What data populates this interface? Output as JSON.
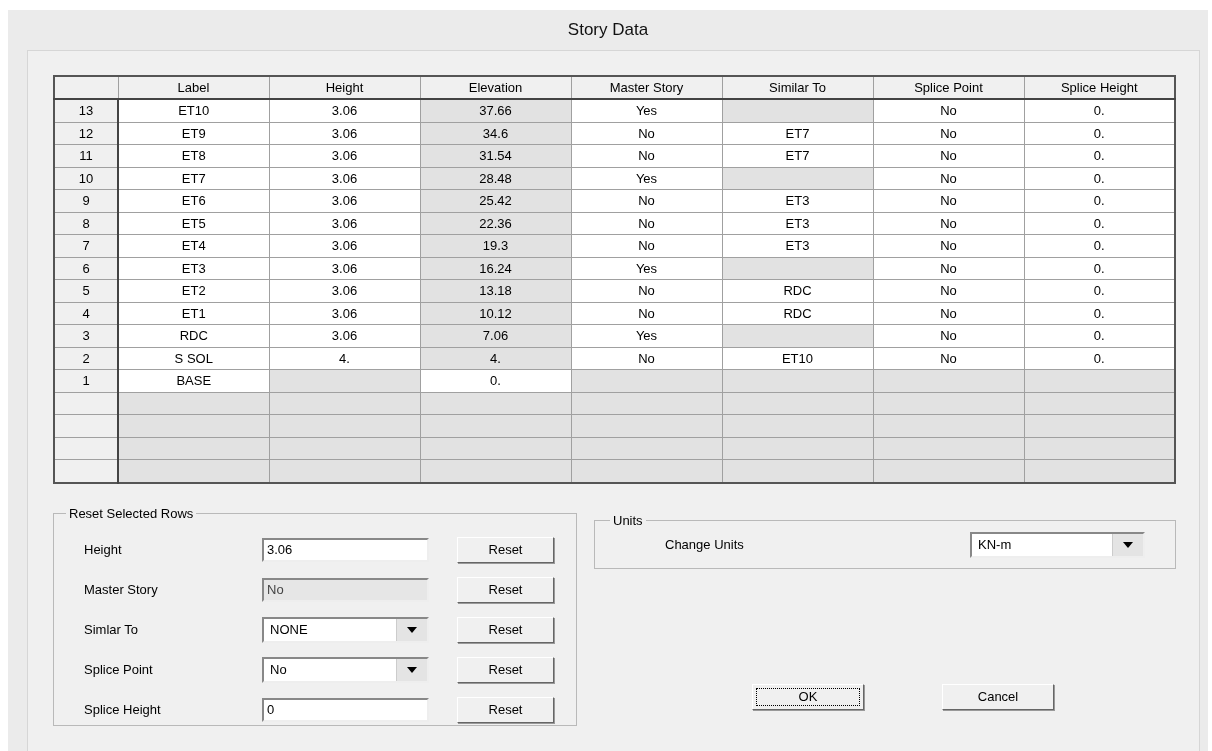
{
  "window": {
    "title": "Story Data"
  },
  "table": {
    "columns": [
      "",
      "Label",
      "Height",
      "Elevation",
      "Master Story",
      "Similar To",
      "Splice Point",
      "Splice Height"
    ],
    "rows": [
      {
        "cells": [
          {
            "kind": "header",
            "text": "13"
          },
          {
            "text": "ET10",
            "shaded": false
          },
          {
            "text": "3.06",
            "shaded": false
          },
          {
            "text": "37.66",
            "shaded": true
          },
          {
            "text": "Yes",
            "shaded": false
          },
          {
            "shaded": true
          },
          {
            "text": "No",
            "shaded": false
          },
          {
            "text": "0.",
            "shaded": false
          }
        ]
      },
      {
        "cells": [
          {
            "kind": "header",
            "text": "12"
          },
          {
            "text": "ET9",
            "shaded": false
          },
          {
            "text": "3.06",
            "shaded": false
          },
          {
            "text": "34.6",
            "shaded": true
          },
          {
            "text": "No",
            "shaded": false
          },
          {
            "text": "ET7",
            "shaded": false
          },
          {
            "text": "No",
            "shaded": false
          },
          {
            "text": "0.",
            "shaded": false
          }
        ]
      },
      {
        "cells": [
          {
            "kind": "header",
            "text": "11"
          },
          {
            "text": "ET8",
            "shaded": false
          },
          {
            "text": "3.06",
            "shaded": false
          },
          {
            "text": "31.54",
            "shaded": true
          },
          {
            "text": "No",
            "shaded": false
          },
          {
            "text": "ET7",
            "shaded": false
          },
          {
            "text": "No",
            "shaded": false
          },
          {
            "text": "0.",
            "shaded": false
          }
        ]
      },
      {
        "cells": [
          {
            "kind": "header",
            "text": "10"
          },
          {
            "text": "ET7",
            "shaded": false
          },
          {
            "text": "3.06",
            "shaded": false
          },
          {
            "text": "28.48",
            "shaded": true
          },
          {
            "text": "Yes",
            "shaded": false
          },
          {
            "shaded": true
          },
          {
            "text": "No",
            "shaded": false
          },
          {
            "text": "0.",
            "shaded": false
          }
        ]
      },
      {
        "cells": [
          {
            "kind": "header",
            "text": "9"
          },
          {
            "text": "ET6",
            "shaded": false
          },
          {
            "text": "3.06",
            "shaded": false
          },
          {
            "text": "25.42",
            "shaded": true
          },
          {
            "text": "No",
            "shaded": false
          },
          {
            "text": "ET3",
            "shaded": false
          },
          {
            "text": "No",
            "shaded": false
          },
          {
            "text": "0.",
            "shaded": false
          }
        ]
      },
      {
        "cells": [
          {
            "kind": "header",
            "text": "8"
          },
          {
            "text": "ET5",
            "shaded": false
          },
          {
            "text": "3.06",
            "shaded": false
          },
          {
            "text": "22.36",
            "shaded": true
          },
          {
            "text": "No",
            "shaded": false
          },
          {
            "text": "ET3",
            "shaded": false
          },
          {
            "text": "No",
            "shaded": false
          },
          {
            "text": "0.",
            "shaded": false
          }
        ]
      },
      {
        "cells": [
          {
            "kind": "header",
            "text": "7"
          },
          {
            "text": "ET4",
            "shaded": false
          },
          {
            "text": "3.06",
            "shaded": false
          },
          {
            "text": "19.3",
            "shaded": true
          },
          {
            "text": "No",
            "shaded": false
          },
          {
            "text": "ET3",
            "shaded": false
          },
          {
            "text": "No",
            "shaded": false
          },
          {
            "text": "0.",
            "shaded": false
          }
        ]
      },
      {
        "cells": [
          {
            "kind": "header",
            "text": "6"
          },
          {
            "text": "ET3",
            "shaded": false
          },
          {
            "text": "3.06",
            "shaded": false
          },
          {
            "text": "16.24",
            "shaded": true
          },
          {
            "text": "Yes",
            "shaded": false
          },
          {
            "shaded": true
          },
          {
            "text": "No",
            "shaded": false
          },
          {
            "text": "0.",
            "shaded": false
          }
        ]
      },
      {
        "cells": [
          {
            "kind": "header",
            "text": "5"
          },
          {
            "text": "ET2",
            "shaded": false
          },
          {
            "text": "3.06",
            "shaded": false
          },
          {
            "text": "13.18",
            "shaded": true
          },
          {
            "text": "No",
            "shaded": false
          },
          {
            "text": "RDC",
            "shaded": false
          },
          {
            "text": "No",
            "shaded": false
          },
          {
            "text": "0.",
            "shaded": false
          }
        ]
      },
      {
        "cells": [
          {
            "kind": "header",
            "text": "4"
          },
          {
            "text": "ET1",
            "shaded": false
          },
          {
            "text": "3.06",
            "shaded": false
          },
          {
            "text": "10.12",
            "shaded": true
          },
          {
            "text": "No",
            "shaded": false
          },
          {
            "text": "RDC",
            "shaded": false
          },
          {
            "text": "No",
            "shaded": false
          },
          {
            "text": "0.",
            "shaded": false
          }
        ]
      },
      {
        "cells": [
          {
            "kind": "header",
            "text": "3"
          },
          {
            "text": "RDC",
            "shaded": false
          },
          {
            "text": "3.06",
            "shaded": false
          },
          {
            "text": "7.06",
            "shaded": true
          },
          {
            "text": "Yes",
            "shaded": false
          },
          {
            "shaded": true
          },
          {
            "text": "No",
            "shaded": false
          },
          {
            "text": "0.",
            "shaded": false
          }
        ]
      },
      {
        "cells": [
          {
            "kind": "header",
            "text": "2"
          },
          {
            "text": "S SOL",
            "shaded": false
          },
          {
            "text": "4.",
            "shaded": false
          },
          {
            "text": "4.",
            "shaded": true
          },
          {
            "text": "No",
            "shaded": false
          },
          {
            "text": "ET10",
            "shaded": false
          },
          {
            "text": "No",
            "shaded": false
          },
          {
            "text": "0.",
            "shaded": false
          }
        ]
      },
      {
        "cells": [
          {
            "kind": "header",
            "text": "1"
          },
          {
            "text": "BASE",
            "shaded": false
          },
          {
            "shaded": true
          },
          {
            "text": "0.",
            "shaded": false
          },
          {
            "shaded": true
          },
          {
            "shaded": true
          },
          {
            "shaded": true
          },
          {
            "shaded": true
          }
        ]
      },
      {
        "cells": [
          {
            "kind": "header"
          },
          {
            "shaded": true
          },
          {
            "shaded": true
          },
          {
            "shaded": true
          },
          {
            "shaded": true
          },
          {
            "shaded": true
          },
          {
            "shaded": true
          },
          {
            "shaded": true
          }
        ]
      },
      {
        "cells": [
          {
            "kind": "header"
          },
          {
            "shaded": true
          },
          {
            "shaded": true
          },
          {
            "shaded": true
          },
          {
            "shaded": true
          },
          {
            "shaded": true
          },
          {
            "shaded": true
          },
          {
            "shaded": true
          }
        ]
      },
      {
        "cells": [
          {
            "kind": "header"
          },
          {
            "shaded": true
          },
          {
            "shaded": true
          },
          {
            "shaded": true
          },
          {
            "shaded": true
          },
          {
            "shaded": true
          },
          {
            "shaded": true
          },
          {
            "shaded": true
          }
        ]
      },
      {
        "cells": [
          {
            "kind": "header"
          },
          {
            "shaded": true
          },
          {
            "shaded": true
          },
          {
            "shaded": true
          },
          {
            "shaded": true
          },
          {
            "shaded": true
          },
          {
            "shaded": true
          },
          {
            "shaded": true
          }
        ]
      }
    ]
  },
  "reset_group": {
    "title": "Reset Selected Rows",
    "rows": [
      {
        "label": "Height",
        "kind": "text",
        "value": "3.06",
        "disabled": false,
        "button": "Reset"
      },
      {
        "label": "Master Story",
        "kind": "text",
        "value": "No",
        "disabled": true,
        "button": "Reset"
      },
      {
        "label": "Simlar To",
        "kind": "select",
        "value": "NONE",
        "button": "Reset"
      },
      {
        "label": "Splice Point",
        "kind": "select",
        "value": "No",
        "button": "Reset"
      },
      {
        "label": "Splice Height",
        "kind": "text",
        "value": "0",
        "disabled": false,
        "button": "Reset"
      }
    ]
  },
  "units_group": {
    "title": "Units",
    "label": "Change Units",
    "value": "KN-m"
  },
  "buttons": [
    {
      "label": "OK",
      "focused": true
    },
    {
      "label": "Cancel",
      "focused": false
    }
  ]
}
